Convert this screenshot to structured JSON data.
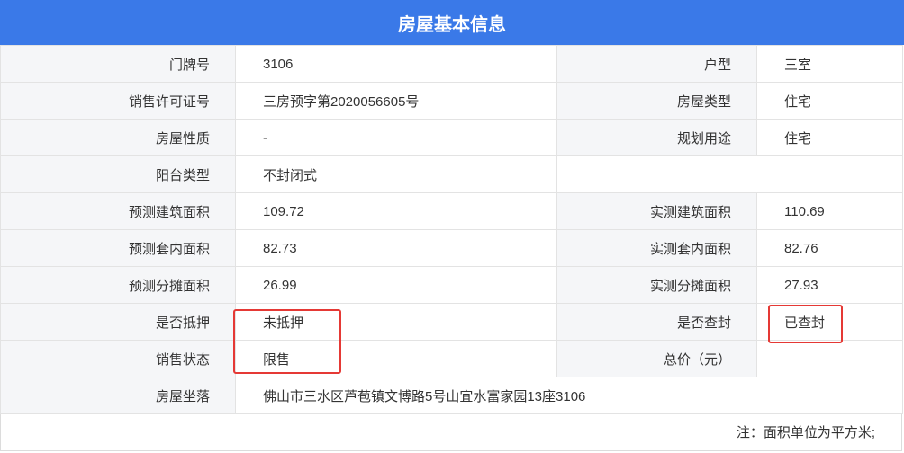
{
  "title": "房屋基本信息",
  "rows": [
    {
      "l1": "门牌号",
      "v1": "3106",
      "l2": "户型",
      "v2": "三室"
    },
    {
      "l1": "销售许可证号",
      "v1": "三房预字第2020056605号",
      "l2": "房屋类型",
      "v2": "住宅"
    },
    {
      "l1": "房屋性质",
      "v1": "-",
      "l2": "规划用途",
      "v2": "住宅"
    },
    {
      "l1": "阳台类型",
      "v1": "不封闭式"
    },
    {
      "l1": "预测建筑面积",
      "v1": "109.72",
      "l2": "实测建筑面积",
      "v2": "110.69"
    },
    {
      "l1": "预测套内面积",
      "v1": "82.73",
      "l2": "实测套内面积",
      "v2": "82.76"
    },
    {
      "l1": "预测分摊面积",
      "v1": "26.99",
      "l2": "实测分摊面积",
      "v2": "27.93"
    },
    {
      "l1": "是否抵押",
      "v1": "未抵押",
      "l2": "是否查封",
      "v2": "已查封"
    },
    {
      "l1": "销售状态",
      "v1": "限售",
      "l2": "总价（元）",
      "v2": ""
    },
    {
      "l1": "房屋坐落",
      "v1": "佛山市三水区芦苞镇文博路5号山宜水富家园13座3106"
    }
  ],
  "note": "注：面积单位为平方米;",
  "colors": {
    "header_bg": "#3a79e8",
    "label_bg": "#f5f6f8",
    "highlight": "#e53935"
  }
}
